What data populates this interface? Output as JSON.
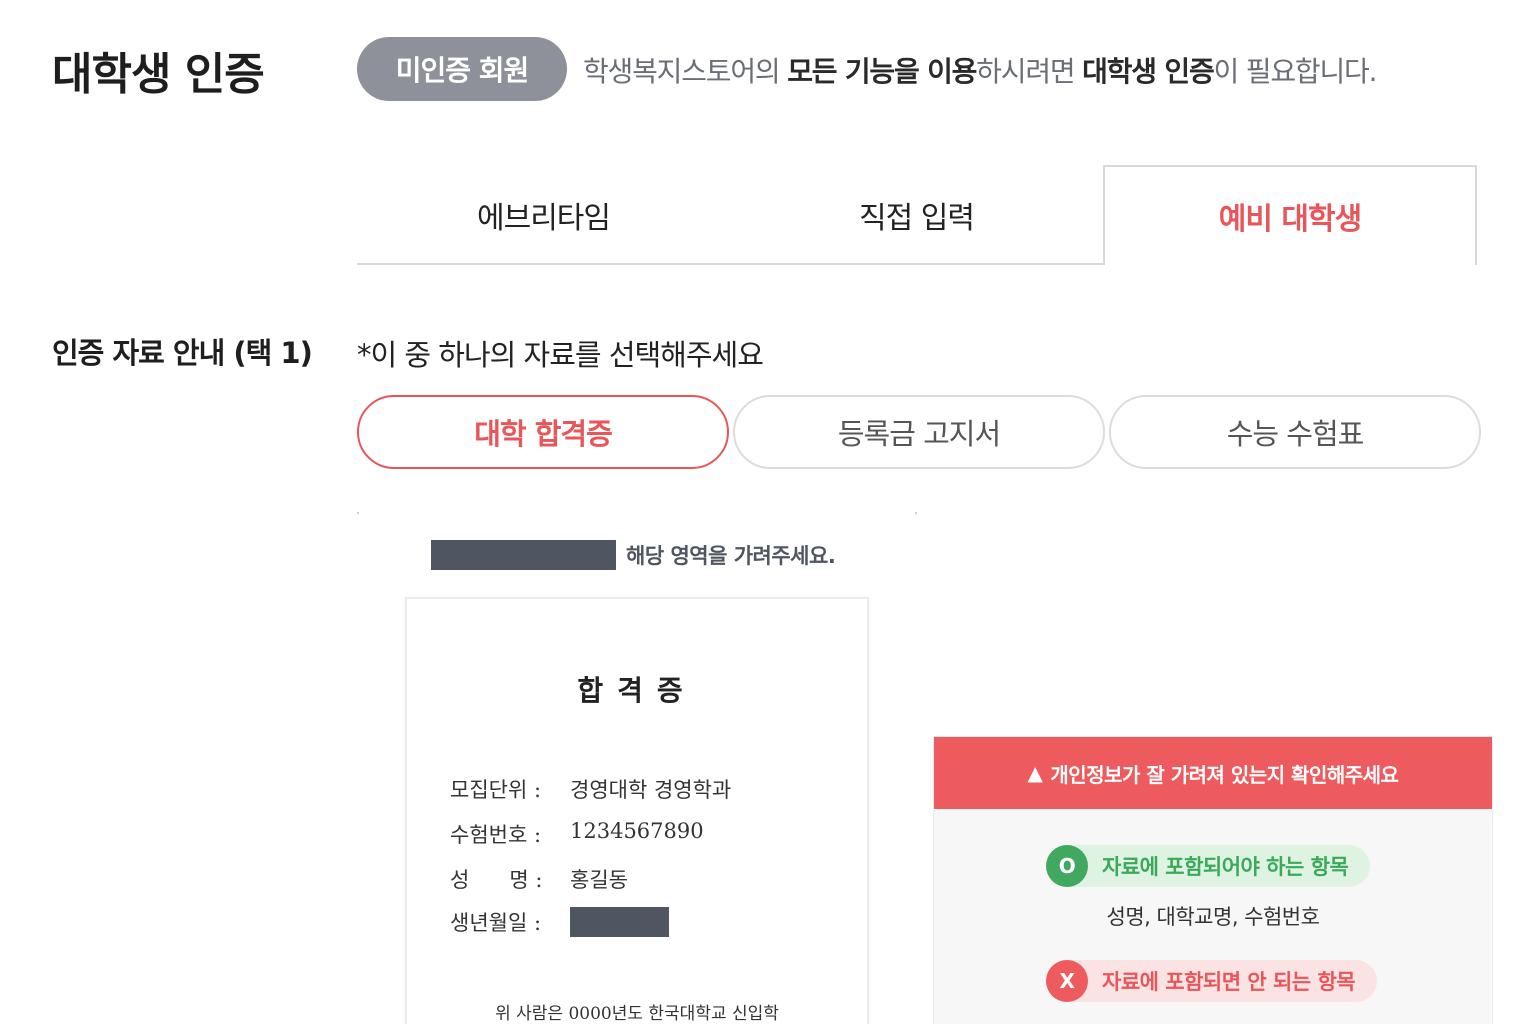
{
  "header": {
    "title": "대학생 인증",
    "badge": "미인증 회원",
    "notice": {
      "p1": "학생복지스토어의 ",
      "b1": "모든 기능을 이용",
      "p2": "하시려면 ",
      "b2": "대학생 인증",
      "p3": "이 필요합니다."
    }
  },
  "tabs": [
    {
      "label": "에브리타임"
    },
    {
      "label": "직접 입력"
    },
    {
      "label": "예비 대학생"
    }
  ],
  "section": {
    "label": "인증 자료 안내 (택 1)",
    "hint": "*이 중 하나의 자료를 선택해주세요"
  },
  "options": [
    {
      "label": "대학 합격증"
    },
    {
      "label": "등록금 고지서"
    },
    {
      "label": "수능 수험표"
    }
  ],
  "sample": {
    "legend": "해당 영역을 가려주세요.",
    "title": "합격증",
    "rows": [
      {
        "key": "모집단위 :",
        "value": "경영대학 경영학과"
      },
      {
        "key": "수험번호 :",
        "value": "1234567890"
      },
      {
        "key": "성      명 :",
        "value": "홍길동"
      },
      {
        "key": "생년월일 :",
        "value": ""
      }
    ],
    "footer": "위 사람은 0000년도 한국대학교 신입학"
  },
  "warning": {
    "title": "개인정보가 잘 가려져 있는지 확인해주세요",
    "ok_mark": "O",
    "ok_label": "자료에 포함되어야 하는 항목",
    "ok_items": "성명, 대학교명, 수험번호",
    "ng_mark": "X",
    "ng_label": "자료에 포함되면 안 되는 항목"
  },
  "colors": {
    "accent": "#e8565a",
    "badge_bg": "#8e9199",
    "mask": "#4f5561",
    "ok": "#41a85f"
  }
}
